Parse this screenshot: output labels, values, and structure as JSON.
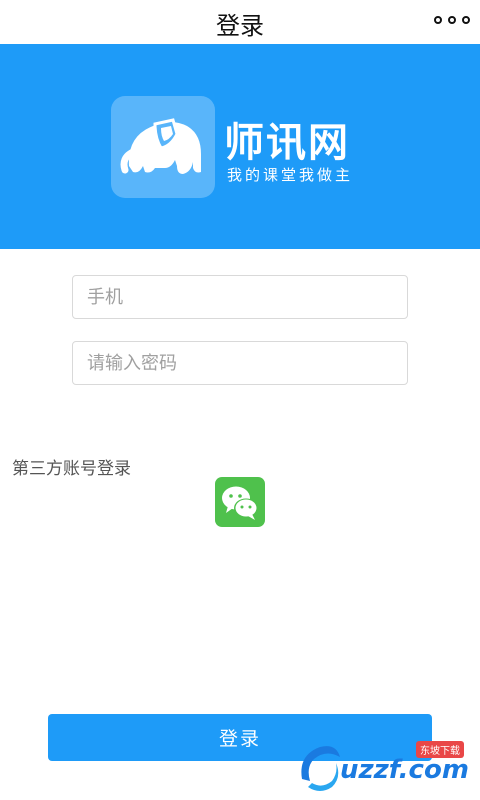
{
  "header": {
    "title": "登录",
    "menu_icon": "more-dots-icon"
  },
  "banner": {
    "background_color": "#1e9bf8",
    "logo_icon": "elephant-logo-icon",
    "brand_name": "师讯网",
    "slogan": "我的课堂我做主"
  },
  "form": {
    "phone": {
      "value": "",
      "placeholder": "手机"
    },
    "password": {
      "value": "",
      "placeholder": "请输入密码"
    }
  },
  "third_party": {
    "label": "第三方账号登录",
    "wechat_icon": "wechat-icon"
  },
  "login_button": {
    "label": "登录",
    "color": "#1e9bf8"
  },
  "watermark": {
    "text": "uzzf.com",
    "tag": "东坡下载"
  }
}
